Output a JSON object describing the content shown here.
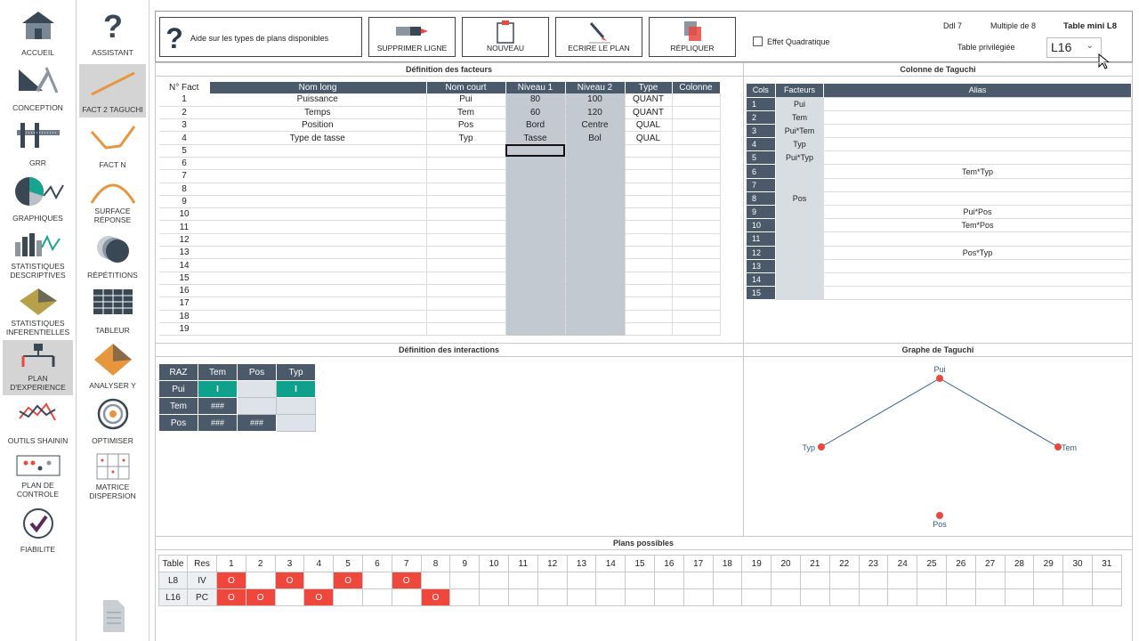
{
  "sidebar_left": [
    {
      "label": "ACCUEIL",
      "icon": "home-icon"
    },
    {
      "label": "CONCEPTION",
      "icon": "conception-icon"
    },
    {
      "label": "GRR",
      "icon": "caliper-icon"
    },
    {
      "label": "GRAPHIQUES",
      "icon": "pie-chart-icon"
    },
    {
      "label": "STATISTIQUES DESCRIPTIVES",
      "icon": "bar-chart-icon"
    },
    {
      "label": "STATISTIQUES INFERENTIELLES",
      "icon": "surface-3d-icon"
    },
    {
      "label": "PLAN D'EXPERIENCE",
      "icon": "doe-icon"
    },
    {
      "label": "OUTILS SHAININ",
      "icon": "shainin-icon"
    },
    {
      "label": "PLAN DE CONTROLE",
      "icon": "control-plan-icon"
    },
    {
      "label": "FIABILITE",
      "icon": "check-icon"
    }
  ],
  "sidebar_right": [
    {
      "label": "ASSISTANT",
      "icon": "question-icon"
    },
    {
      "label": "FACT 2 TAGUCHI",
      "icon": "fact2-taguchi-icon"
    },
    {
      "label": "FACT N",
      "icon": "fact-n-icon"
    },
    {
      "label": "SURFACE RÉPONSE",
      "icon": "response-surface-icon"
    },
    {
      "label": "RÉPÉTITIONS",
      "icon": "repetitions-icon"
    },
    {
      "label": "TABLEUR",
      "icon": "spreadsheet-icon"
    },
    {
      "label": "ANALYSER Y",
      "icon": "analyse-y-icon"
    },
    {
      "label": "OPTIMISER",
      "icon": "target-icon"
    },
    {
      "label": "MATRICE DISPERSION",
      "icon": "scatter-matrix-icon"
    },
    {
      "label": "",
      "icon": "document-icon"
    }
  ],
  "toolbar": {
    "help_text": "Aide sur les types de plans disponibles",
    "delete_line": "SUPPRIMER LIGNE",
    "new": "NOUVEAU",
    "write_plan": "ECRIRE LE PLAN",
    "replicate": "RÉPLIQUER"
  },
  "options": {
    "quadratic_label": "Effet Quadratique",
    "quadratic_checked": false,
    "ddl": "Ddl 7",
    "multiple": "Multiple de 8",
    "table_mini": "Table mini L8",
    "preferred_label": "Table privilégiée",
    "preferred_value": "L16"
  },
  "sections": {
    "factors": "Définition des facteurs",
    "taguchi_cols": "Colonne de Taguchi",
    "interactions": "Définition des interactions",
    "taguchi_graph": "Graphe de Taguchi",
    "plans": "Plans possibles"
  },
  "factors": {
    "headers": [
      "N° Fact",
      "Nom long",
      "Nom court",
      "Niveau 1",
      "Niveau 2",
      "Type",
      "Colonne"
    ],
    "rows": [
      [
        "1",
        "Puissance",
        "Pui",
        "80",
        "100",
        "QUANT",
        ""
      ],
      [
        "2",
        "Temps",
        "Tem",
        "60",
        "120",
        "QUANT",
        ""
      ],
      [
        "3",
        "Position",
        "Pos",
        "Bord",
        "Centre",
        "QUAL",
        ""
      ],
      [
        "4",
        "Type de tasse",
        "Typ",
        "Tasse",
        "Bol",
        "QUAL",
        ""
      ],
      [
        "5",
        "",
        "",
        "",
        "",
        "",
        ""
      ],
      [
        "6",
        "",
        "",
        "",
        "",
        "",
        ""
      ],
      [
        "7",
        "",
        "",
        "",
        "",
        "",
        ""
      ],
      [
        "8",
        "",
        "",
        "",
        "",
        "",
        ""
      ],
      [
        "9",
        "",
        "",
        "",
        "",
        "",
        ""
      ],
      [
        "10",
        "",
        "",
        "",
        "",
        "",
        ""
      ],
      [
        "11",
        "",
        "",
        "",
        "",
        "",
        ""
      ],
      [
        "12",
        "",
        "",
        "",
        "",
        "",
        ""
      ],
      [
        "13",
        "",
        "",
        "",
        "",
        "",
        ""
      ],
      [
        "14",
        "",
        "",
        "",
        "",
        "",
        ""
      ],
      [
        "15",
        "",
        "",
        "",
        "",
        "",
        ""
      ],
      [
        "16",
        "",
        "",
        "",
        "",
        "",
        ""
      ],
      [
        "17",
        "",
        "",
        "",
        "",
        "",
        ""
      ],
      [
        "18",
        "",
        "",
        "",
        "",
        "",
        ""
      ],
      [
        "19",
        "",
        "",
        "",
        "",
        "",
        ""
      ]
    ]
  },
  "taguchi": {
    "headers": [
      "Cols",
      "Facteurs",
      "Alias"
    ],
    "rows": [
      [
        "1",
        "Pui",
        ""
      ],
      [
        "2",
        "Tem",
        ""
      ],
      [
        "3",
        "Pui*Tem",
        ""
      ],
      [
        "4",
        "Typ",
        ""
      ],
      [
        "5",
        "Pui*Typ",
        ""
      ],
      [
        "6",
        "",
        "Tem*Typ"
      ],
      [
        "7",
        "",
        ""
      ],
      [
        "8",
        "Pos",
        ""
      ],
      [
        "9",
        "",
        "Pui*Pos"
      ],
      [
        "10",
        "",
        "Tem*Pos"
      ],
      [
        "11",
        "",
        ""
      ],
      [
        "12",
        "",
        "Pos*Typ"
      ],
      [
        "13",
        "",
        ""
      ],
      [
        "14",
        "",
        ""
      ],
      [
        "15",
        "",
        ""
      ]
    ]
  },
  "interactions": {
    "corner": "RAZ",
    "cols": [
      "Tem",
      "Pos",
      "Typ"
    ],
    "rows": [
      {
        "label": "Pui",
        "cells": [
          "I",
          "",
          "I"
        ]
      },
      {
        "label": "Tem",
        "cells": [
          "###",
          "",
          ""
        ]
      },
      {
        "label": "Pos",
        "cells": [
          "###",
          "###",
          ""
        ]
      }
    ]
  },
  "graph": {
    "nodes": [
      {
        "name": "Pui",
        "linked": true
      },
      {
        "name": "Typ",
        "linked": true
      },
      {
        "name": "Tem",
        "linked": true
      },
      {
        "name": "Pos",
        "linked": false
      }
    ],
    "edges": [
      [
        "Pui",
        "Typ"
      ],
      [
        "Pui",
        "Tem"
      ]
    ],
    "node_color": "#e8483e",
    "edge_color": "#2c5a8a"
  },
  "plans": {
    "header_table": "Table",
    "header_res": "Res",
    "columns": [
      "1",
      "2",
      "3",
      "4",
      "5",
      "6",
      "7",
      "8",
      "9",
      "10",
      "11",
      "12",
      "13",
      "14",
      "15",
      "16",
      "17",
      "18",
      "19",
      "20",
      "21",
      "22",
      "23",
      "24",
      "25",
      "26",
      "27",
      "28",
      "29",
      "30",
      "31"
    ],
    "rows": [
      {
        "table": "L8",
        "res": "IV",
        "marks": {
          "1": "O",
          "3": "O",
          "5": "O",
          "7": "O"
        }
      },
      {
        "table": "L16",
        "res": "PC",
        "marks": {
          "1": "O",
          "2": "O",
          "4": "O",
          "8": "O"
        }
      }
    ]
  },
  "colors": {
    "header_dark": "#4a5a6a",
    "selected_green": "#0fa18c",
    "plan_red": "#f0473c",
    "level_grey": "#c2c9d0"
  }
}
